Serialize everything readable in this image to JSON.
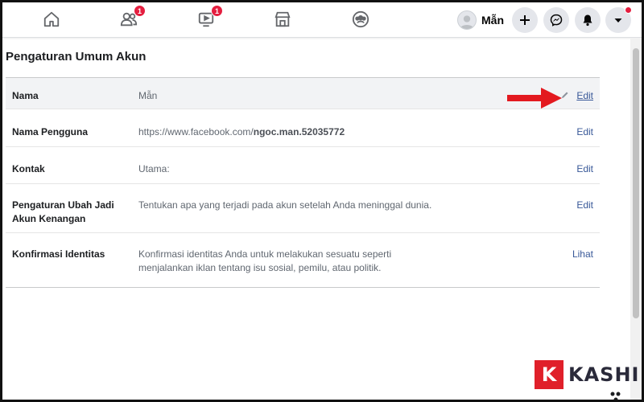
{
  "nav": {
    "items": [
      {
        "name": "home-icon",
        "badge": ""
      },
      {
        "name": "friends-icon",
        "badge": "1"
      },
      {
        "name": "watch-icon",
        "badge": "1"
      },
      {
        "name": "marketplace-icon",
        "badge": ""
      },
      {
        "name": "groups-icon",
        "badge": ""
      }
    ],
    "profile_name": "Mẫn",
    "buttons": [
      "plus-icon",
      "messenger-icon",
      "bell-icon",
      "caret-down-icon"
    ]
  },
  "page": {
    "title": "Pengaturan Umum Akun"
  },
  "settings": [
    {
      "label": "Nama",
      "value": "Mẫn",
      "value_bold": "",
      "action": "Edit"
    },
    {
      "label": "Nama Pengguna",
      "value": "https://www.facebook.com/",
      "value_bold": "ngoc.man.52035772",
      "action": "Edit"
    },
    {
      "label": "Kontak",
      "value": "Utama:",
      "value_bold": "",
      "action": "Edit"
    },
    {
      "label": "Pengaturan Ubah Jadi Akun Kenangan",
      "value": "Tentukan apa yang terjadi pada akun setelah Anda meninggal dunia.",
      "value_bold": "",
      "action": "Edit"
    },
    {
      "label": "Konfirmasi Identitas",
      "value": "Konfirmasi identitas Anda untuk melakukan sesuatu seperti menjalankan iklan tentang isu sosial, pemilu, atau politik.",
      "value_bold": "",
      "action": "Lihat"
    }
  ],
  "annotation": {
    "arrow_color": "#e3191f"
  },
  "colors": {
    "link": "#385898",
    "badge": "#e41e3f",
    "highlight_row": "#f2f3f5"
  },
  "watermark": {
    "letter": "K",
    "text": "KASHI",
    "color": "#e0202a"
  }
}
